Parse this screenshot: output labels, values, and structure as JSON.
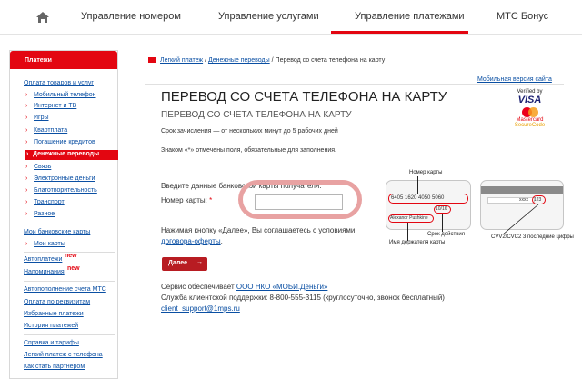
{
  "nav": {
    "tabs": [
      "Управление номером",
      "Управление услугами",
      "Управление платежами",
      "МТС Бонус"
    ]
  },
  "sidebar": {
    "header": "Платежи",
    "group1_title": "Оплата товаров и услуг",
    "group1_items": [
      "Мобильный телефон",
      "Интернет и ТВ",
      "Игры",
      "Квартплата",
      "Погашение кредитов"
    ],
    "active_item": "Денежные переводы",
    "group1_items_after": [
      "Связь",
      "Электронные деньги",
      "Благотворительность",
      "Транспорт",
      "Разное"
    ],
    "cards_title": "Мои банковские карты",
    "cards_item": "Мои карты",
    "autopay": "Автоплатежи",
    "reminders": "Напоминания",
    "new_label": "new",
    "links2": [
      "Автопополнение счета МТС",
      "Оплата по реквизитам",
      "Избранные платежи",
      "История платежей"
    ],
    "links3": [
      "Справка и тарифы",
      "Легкий платеж с телефона",
      "Как стать партнером"
    ]
  },
  "breadcrumb": {
    "item1": "Легкий платеж",
    "sep": "/",
    "item2": "Денежные переводы",
    "current": "Перевод со счета телефона на карту"
  },
  "mobile_link": "Мобильная версия сайта",
  "page": {
    "title": "ПЕРЕВОД СО СЧЕТА ТЕЛЕФОНА НА КАРТУ",
    "subtitle": "ПЕРЕВОД СО СЧЕТА ТЕЛЕФОНА НА КАРТУ",
    "term": "Срок зачисления — от нескольких минут до 5 рабочих дней",
    "required_note": "Знаком «*» отмечены поля, обязательные для заполнения."
  },
  "logos": {
    "verified": "Verified by",
    "visa": "VISA",
    "mastercard": "Mastercard",
    "securecode": "SecureCode"
  },
  "form": {
    "bank_label": "Введите данные банковской карты получателя:",
    "card_label": "Номер карты:",
    "required_star": "*",
    "card_value": "",
    "agree_text": "Нажимая кнопку «Далее», Вы соглашаетесь с условиями",
    "agree_link": "договора-оферты",
    "agree_end": ".",
    "next_button": "Далее"
  },
  "card_front": {
    "number_caption": "Номер карты",
    "number": "6405 1620 4050 5060",
    "expiry_value": "10/16",
    "holder": "Alexandr Pushkine",
    "expiry_caption": "Срок действия",
    "holder_caption": "Имя держателя карты"
  },
  "card_back": {
    "cvv_mask": "xxxx",
    "cvv_value": "123",
    "caption": "CVV2/CVC2 3 последние цифры"
  },
  "service": {
    "provider_text": "Сервис обеспечивает",
    "provider_link": "ООО НКО «МОБИ.Деньги»",
    "support": "Служба клиентской поддержки: 8-800-555-3115 (круглосуточно, звонок бесплатный)",
    "email": "client_support@1mps.ru"
  },
  "colors": {
    "accent": "#e30611",
    "link": "#0a4fa3",
    "button": "#b81c22"
  }
}
